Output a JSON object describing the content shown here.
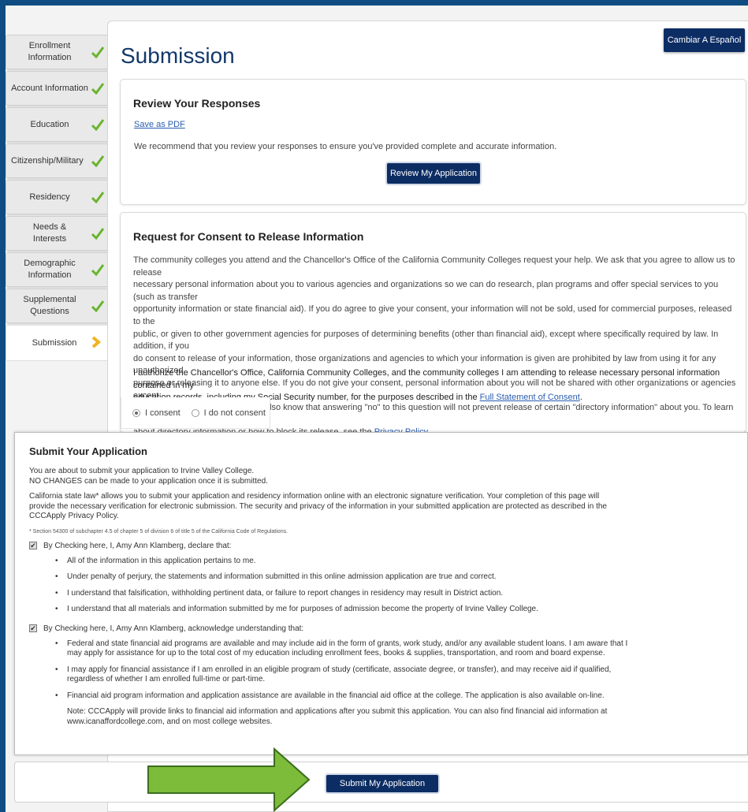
{
  "sidebar": {
    "items": [
      {
        "label": "Enrollment Information",
        "icon": "check-icon"
      },
      {
        "label": "Account Information",
        "icon": "check-icon"
      },
      {
        "label": "Education",
        "icon": "check-icon"
      },
      {
        "label": "Citizenship/Military",
        "icon": "check-icon"
      },
      {
        "label": "Residency",
        "icon": "check-icon"
      },
      {
        "label": "Needs & Interests",
        "icon": "check-icon"
      },
      {
        "label": "Demographic Information",
        "icon": "check-icon"
      },
      {
        "label": "Supplemental Questions",
        "icon": "check-icon"
      },
      {
        "label": "Submission",
        "icon": "chevron-right-icon"
      }
    ]
  },
  "page": {
    "title": "Submission",
    "lang_button": "Cambiar A Español"
  },
  "review": {
    "heading": "Review Your Responses",
    "pdf_link": "Save as PDF",
    "text": "We recommend that you review your responses to ensure you've provided complete and accurate information.",
    "button": "Review My Application"
  },
  "consent": {
    "heading": "Request for Consent to Release Information",
    "body_lines": [
      "The community colleges you attend and the Chancellor's Office of the California Community Colleges request your help. We ask that you agree to allow us to release",
      "necessary personal information about you to various agencies and organizations so we can do research, plan programs and offer special services to you (such as transfer",
      "opportunity information or state financial aid). If you do agree to give your consent, your information will not be sold, used for commercial purposes, released to the",
      "public, or given to other government agencies for purposes of determining benefits (other than financial aid), except where specifically required by law. In addition, if you",
      "do consent to release of your information, those organizations and agencies to which your information is given are prohibited by law from using it for any unauthorized",
      "purpose or releasing it to anyone else. If you do not give your consent, personal information about you will not be shared with other organizations or agencies except",
      "where allowed by law. You should also know that answering \"no\" to this question will not prevent release of certain \"directory information\" about you. To learn more"
    ],
    "body_last_prefix": "about directory information or how to block its release, see the ",
    "privacy_link": "Privacy Policy",
    "authorize_line1": "I authorize the Chancellor's Office, California Community Colleges, and the community colleges I am attending to release necessary personal information contained in my",
    "authorize_line2_prefix": "education records, including my Social Security number, for the purposes described in the ",
    "full_statement_link": "Full Statement of Consent",
    "option_consent": "I consent",
    "option_not_consent": "I do not consent"
  },
  "submit_panel": {
    "heading": "Submit Your Application",
    "about_line1": "You are about to submit your application to Irvine Valley College.",
    "about_line2": "NO CHANGES can be made to your application once it is submitted.",
    "law_line1": "California state law* allows you to submit your application and residency information online with an electronic signature verification. Your completion of this page will",
    "law_line2": "provide the necessary verification for electronic submission. The security and privacy of the information in your submitted application are protected as described in the",
    "law_line3": "CCCApply Privacy Policy.",
    "footnote": "* Section 54300 of subchapter 4.5 of chapter 5 of division 6 of title 5 of the California Code of Regulations.",
    "declare_label": "By Checking here, I, Amy Ann Klamberg, declare that:",
    "declare_items": [
      "All of the information in this application pertains to me.",
      "Under penalty of perjury, the statements and information submitted in this online admission application are true and correct.",
      "I understand that falsification, withholding pertinent data, or failure to report changes in residency may result in District action.",
      "I understand that all materials and information submitted by me for purposes of admission become the property of Irvine Valley College."
    ],
    "ack_label": "By Checking here, I, Amy Ann Klamberg, acknowledge understanding that:",
    "ack_items": [
      {
        "l1": "Federal and state financial aid programs are available and may include aid in the form of grants, work study, and/or any available student loans. I am aware that I",
        "l2": "may apply for assistance for up to the total cost of my education including enrollment fees, books & supplies, transportation, and room and board expense."
      },
      {
        "l1": "I may apply for financial assistance if I am enrolled in an eligible program of study (certificate, associate degree, or transfer), and may receive aid if qualified,",
        "l2": "regardless of whether I am enrolled full-time or part-time."
      },
      {
        "l1": "Financial aid program information and application assistance are available in the financial aid office at the college. The application is also available on-line.",
        "l2": ""
      }
    ],
    "note_line1": "Note: CCCApply will provide links to financial aid information and applications after you submit this application. You can also find financial aid information at",
    "note_line2": "www.icanaffordcollege.com, and on most college websites."
  },
  "bottom": {
    "submit_button": "Submit My Application"
  },
  "colors": {
    "frame": "#0f4c81",
    "primary_button": "#0c2d64",
    "check_green": "#6ab42d",
    "chevron_gold": "#f0b323",
    "arrow_green": "#7dbb3a"
  }
}
